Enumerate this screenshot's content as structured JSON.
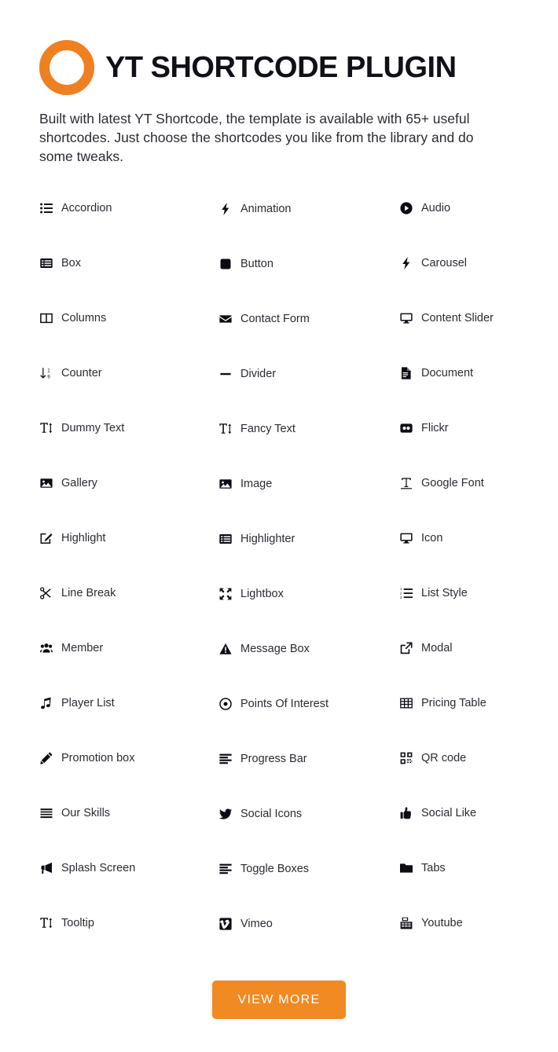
{
  "header": {
    "logo_icon": "orange-ring-logo",
    "title": "YT SHORTCODE PLUGIN",
    "accent_color": "#ef8022"
  },
  "intro": {
    "text": "Built with latest YT Shortcode, the template is available with 65+ useful shortcodes. Just choose the shortcodes you like from the library and do some tweaks."
  },
  "shortcodes": {
    "columns": 3,
    "items": [
      {
        "label": "Accordion",
        "icon": "list-ul-icon"
      },
      {
        "label": "Animation",
        "icon": "bolt-icon"
      },
      {
        "label": "Audio",
        "icon": "play-circle-icon"
      },
      {
        "label": "Box",
        "icon": "list-alt-icon"
      },
      {
        "label": "Button",
        "icon": "square-filled-icon"
      },
      {
        "label": "Carousel",
        "icon": "bolt-icon"
      },
      {
        "label": "Columns",
        "icon": "columns-icon"
      },
      {
        "label": "Contact Form",
        "icon": "envelope-icon"
      },
      {
        "label": "Content Slider",
        "icon": "desktop-icon"
      },
      {
        "label": "Counter",
        "icon": "sort-numeric-icon"
      },
      {
        "label": "Divider",
        "icon": "minus-icon"
      },
      {
        "label": "Document",
        "icon": "file-text-icon"
      },
      {
        "label": "Dummy Text",
        "icon": "text-height-icon"
      },
      {
        "label": "Fancy Text",
        "icon": "text-height-icon"
      },
      {
        "label": "Flickr",
        "icon": "flickr-icon"
      },
      {
        "label": "Gallery",
        "icon": "image-icon"
      },
      {
        "label": "Image",
        "icon": "image-icon"
      },
      {
        "label": "Google Font",
        "icon": "text-width-icon"
      },
      {
        "label": "Highlight",
        "icon": "pencil-square-icon"
      },
      {
        "label": "Highlighter",
        "icon": "list-alt-icon"
      },
      {
        "label": "Icon",
        "icon": "desktop-icon"
      },
      {
        "label": "Line Break",
        "icon": "scissors-icon"
      },
      {
        "label": "Lightbox",
        "icon": "expand-arrows-icon"
      },
      {
        "label": "List Style",
        "icon": "list-ol-icon"
      },
      {
        "label": "Member",
        "icon": "users-icon"
      },
      {
        "label": "Message Box",
        "icon": "warning-triangle-icon"
      },
      {
        "label": "Modal",
        "icon": "external-link-icon"
      },
      {
        "label": "Player List",
        "icon": "music-note-icon"
      },
      {
        "label": "Points Of Interest",
        "icon": "dot-circle-icon"
      },
      {
        "label": "Pricing Table",
        "icon": "table-icon"
      },
      {
        "label": "Promotion box",
        "icon": "pencil-icon"
      },
      {
        "label": "Progress Bar",
        "icon": "align-bars-icon"
      },
      {
        "label": "QR code",
        "icon": "qrcode-icon"
      },
      {
        "label": "Our Skills",
        "icon": "align-justify-icon"
      },
      {
        "label": "Social Icons",
        "icon": "twitter-bird-icon"
      },
      {
        "label": "Social Like",
        "icon": "thumbs-up-icon"
      },
      {
        "label": "Splash Screen",
        "icon": "bullhorn-icon"
      },
      {
        "label": "Toggle Boxes",
        "icon": "align-bars-icon"
      },
      {
        "label": "Tabs",
        "icon": "folder-icon"
      },
      {
        "label": "Tooltip",
        "icon": "text-height-icon"
      },
      {
        "label": "Vimeo",
        "icon": "vimeo-icon"
      },
      {
        "label": "Youtube",
        "icon": "youtube-icon"
      }
    ]
  },
  "cta": {
    "label": "VIEW MORE",
    "background_color": "#f18a23",
    "text_color": "#ffffff"
  }
}
